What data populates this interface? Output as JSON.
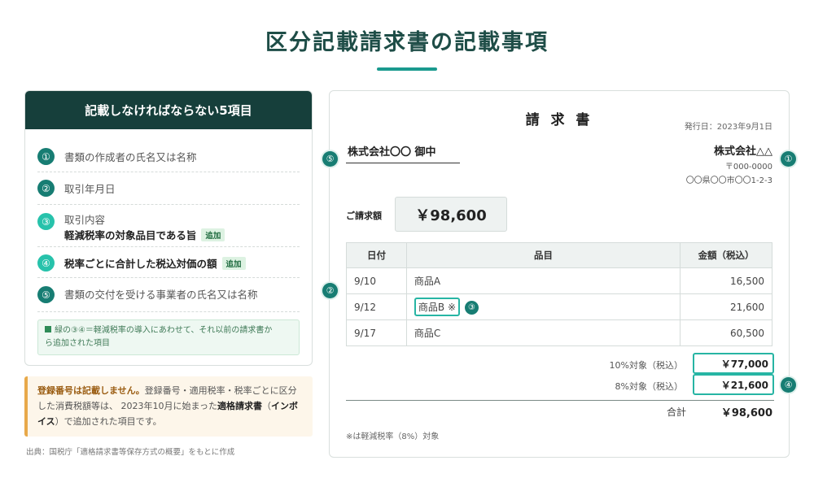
{
  "title": "区分記載請求書の記載事項",
  "requirements": {
    "header": "記載しなければならない5項目",
    "items": [
      {
        "num": "①",
        "text": "書類の作成者の氏名又は名称"
      },
      {
        "num": "②",
        "text": "取引年月日"
      },
      {
        "num": "③",
        "text": "取引内容",
        "subtext": "軽減税率の対象品目である旨",
        "tag": "追加"
      },
      {
        "num": "④",
        "text": "税率ごとに合計した税込対価の額",
        "tag": "追加"
      },
      {
        "num": "⑤",
        "text": "書類の交付を受ける事業者の氏名又は名称"
      }
    ],
    "note_line1": "緑の③④＝軽減税率の導入にあわせて、それ以前の請求書か",
    "note_line2": "ら追加された項目"
  },
  "warning": {
    "bold": "登録番号は記載しません。",
    "part1": "登録番号・適用税率・税率ごとに区分した消費税額等は、 2023年10月に始まった",
    "strong1": "適格請求書",
    "paren_open": "（",
    "strong2": "インボイス",
    "paren_close": "）",
    "part2": "で追加された項目です。"
  },
  "source": "出典：国税庁「適格請求書等保存方式の概要」をもとに作成",
  "invoice": {
    "title": "請 求 書",
    "date": "発行日：2023年9月1日",
    "client": "株式会社〇〇 御中",
    "issuer_name": "株式会社△△",
    "issuer_zip": "〒000-0000",
    "issuer_address": "〇〇県〇〇市〇〇1-2-3",
    "amount_label": "ご請求額",
    "amount": "￥98,600",
    "columns": [
      "日付",
      "品目",
      "金額（税込）"
    ],
    "rows": [
      {
        "date": "9/10",
        "item": "商品A",
        "amount": "16,500"
      },
      {
        "date": "9/12",
        "item": "商品B ※",
        "amount": "21,600"
      },
      {
        "date": "9/17",
        "item": "商品C",
        "amount": "60,500"
      }
    ],
    "subtotal10_label": "10%対象（税込）",
    "subtotal10": "￥77,000",
    "subtotal8_label": "8%対象（税込）",
    "subtotal8": "￥21,600",
    "total_label": "合計",
    "total": "￥98,600",
    "footnote": "※は軽減税率（8%）対象"
  },
  "markers": {
    "m1": "①",
    "m2": "②",
    "m3": "③",
    "m4": "④",
    "m5": "⑤"
  }
}
